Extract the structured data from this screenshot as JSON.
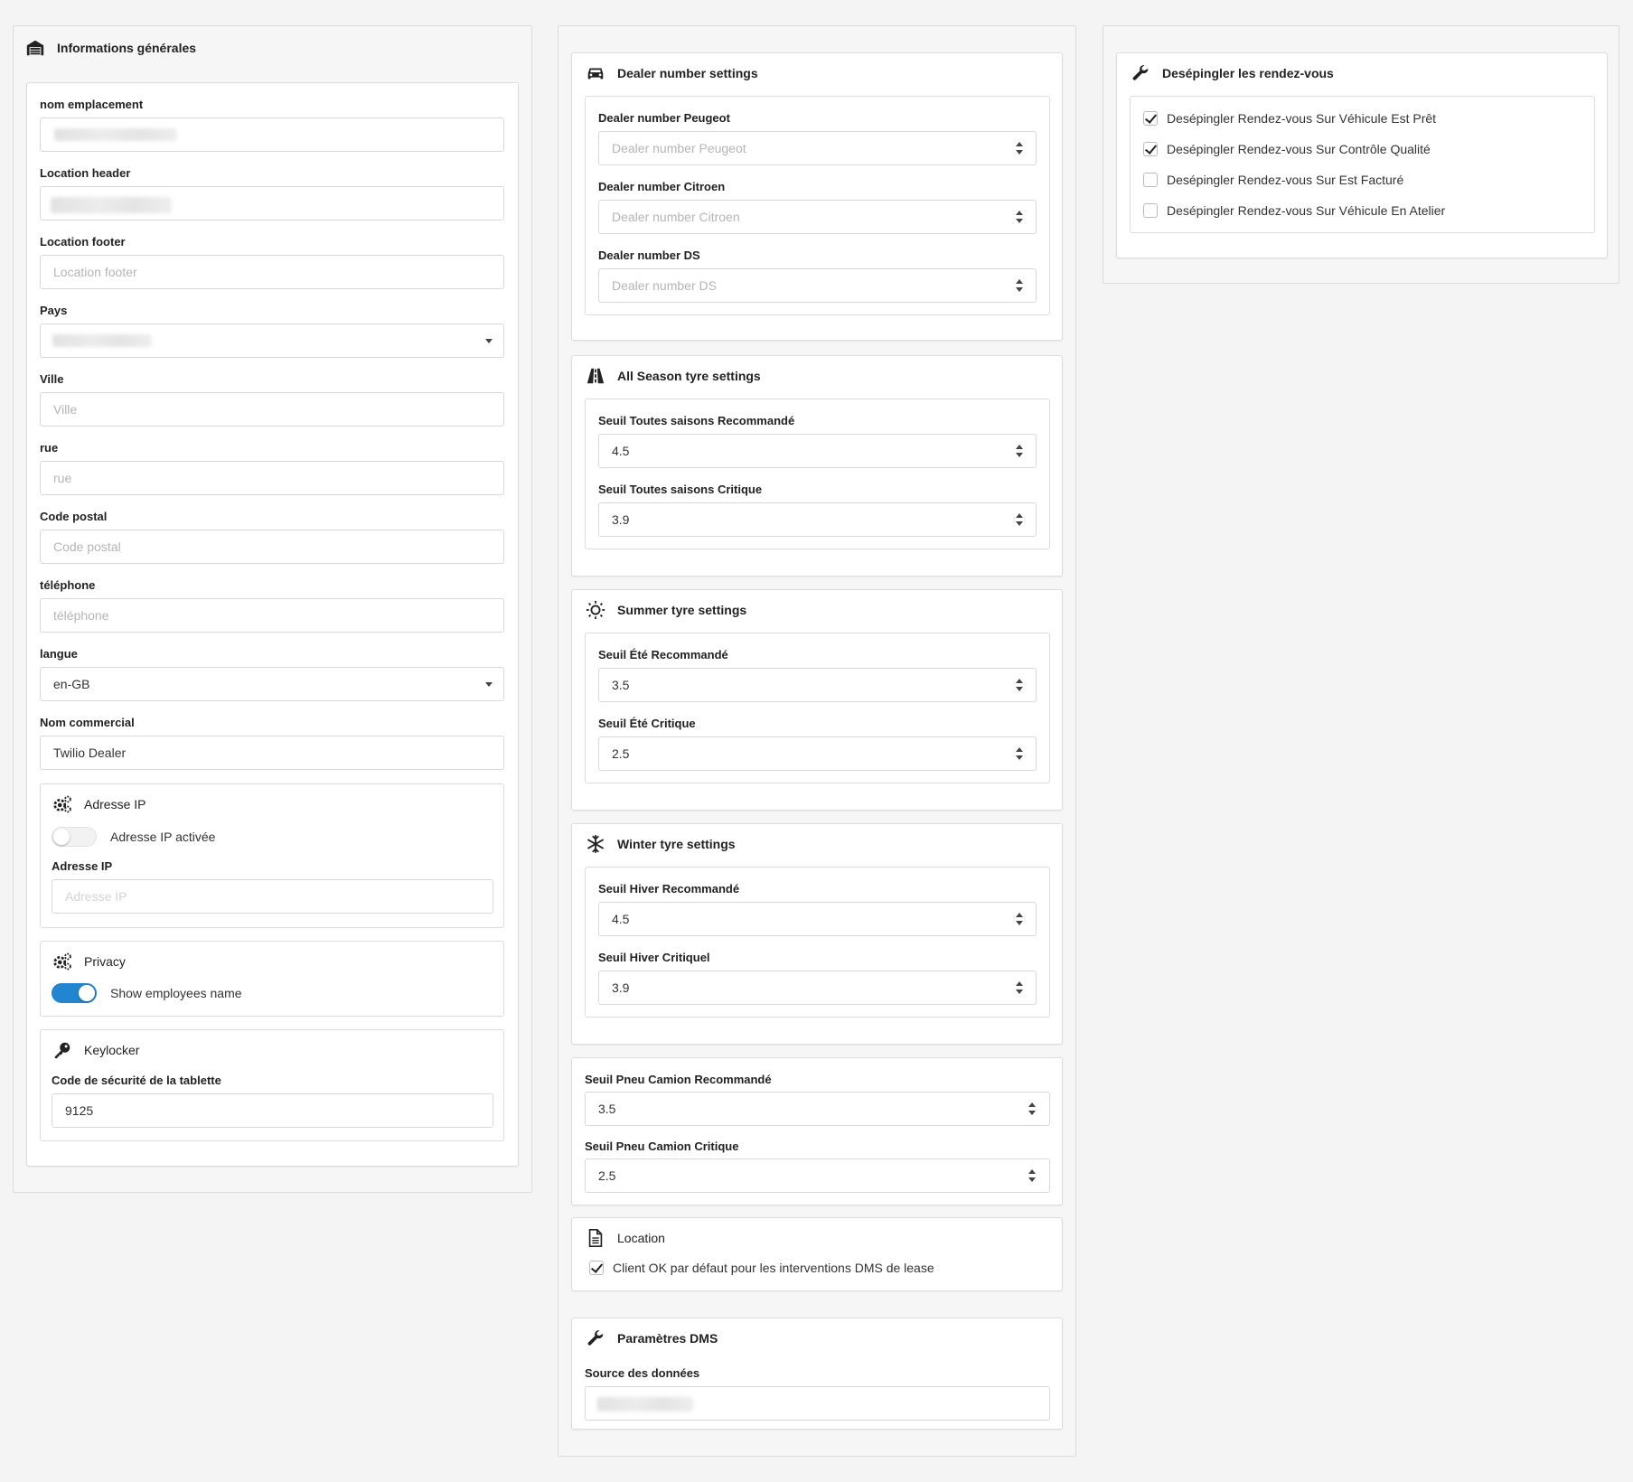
{
  "general": {
    "title": "Informations générales",
    "icon": "warehouse-icon",
    "fields": {
      "location_name": {
        "label": "nom emplacement",
        "value": ""
      },
      "location_header": {
        "label": "Location header",
        "value": ""
      },
      "location_footer": {
        "label": "Location footer",
        "placeholder": "Location footer"
      },
      "country": {
        "label": "Pays",
        "value": ""
      },
      "city": {
        "label": "Ville",
        "placeholder": "Ville"
      },
      "street": {
        "label": "rue",
        "placeholder": "rue"
      },
      "postal_code": {
        "label": "Code postal",
        "placeholder": "Code postal"
      },
      "phone": {
        "label": "téléphone",
        "placeholder": "téléphone"
      },
      "language": {
        "label": "langue",
        "value": "en-GB"
      },
      "commercial_name": {
        "label": "Nom commercial",
        "value": "Twilio Dealer"
      }
    },
    "ip": {
      "title": "Adresse IP",
      "icon": "cogs-icon",
      "toggle_label": "Adresse IP activée",
      "toggle_on": false,
      "field_label": "Adresse IP",
      "placeholder": "Adresse IP"
    },
    "privacy": {
      "title": "Privacy",
      "icon": "cogs-icon",
      "toggle_label": "Show employees name",
      "toggle_on": true
    },
    "keylocker": {
      "title": "Keylocker",
      "icon": "key-icon",
      "field_label": "Code de sécurité de la tablette",
      "value": "9125"
    }
  },
  "dealer": {
    "title": "Dealer number settings",
    "icon": "car-icon",
    "peugeot": {
      "label": "Dealer number Peugeot",
      "placeholder": "Dealer number Peugeot"
    },
    "citroen": {
      "label": "Dealer number Citroen",
      "placeholder": "Dealer number Citroen"
    },
    "ds": {
      "label": "Dealer number DS",
      "placeholder": "Dealer number DS"
    }
  },
  "all_season": {
    "title": "All Season tyre settings",
    "icon": "road-icon",
    "recommended": {
      "label": "Seuil Toutes saisons Recommandé",
      "value": "4.5"
    },
    "critical": {
      "label": "Seuil Toutes saisons Critique",
      "value": "3.9"
    }
  },
  "summer": {
    "title": "Summer tyre settings",
    "icon": "sun-icon",
    "recommended": {
      "label": "Seuil Été Recommandé",
      "value": "3.5"
    },
    "critical": {
      "label": "Seuil Été Critique",
      "value": "2.5"
    }
  },
  "winter": {
    "title": "Winter tyre settings",
    "icon": "snowflake-icon",
    "recommended": {
      "label": "Seuil Hiver Recommandé",
      "value": "4.5"
    },
    "critical": {
      "label": "Seuil Hiver Critiquel",
      "value": "3.9"
    }
  },
  "truck": {
    "recommended": {
      "label": "Seuil Pneu Camion Recommandé",
      "value": "3.5"
    },
    "critical": {
      "label": "Seuil Pneu Camion Critique",
      "value": "2.5"
    }
  },
  "location": {
    "title": "Location",
    "icon": "file-icon",
    "checkbox_label": "Client OK par défaut pour les interventions DMS de lease",
    "checked": true
  },
  "dms": {
    "title": "Paramètres DMS",
    "icon": "wrench-icon",
    "source_label": "Source des données",
    "source_value": ""
  },
  "unpin": {
    "title": "Desépingler les rendez-vous",
    "icon": "wrench-icon",
    "items": [
      {
        "label": "Desépingler Rendez-vous Sur Véhicule Est Prêt",
        "checked": true
      },
      {
        "label": "Desépingler Rendez-vous Sur Contrôle Qualité",
        "checked": true
      },
      {
        "label": "Desépingler Rendez-vous Sur Est Facturé",
        "checked": false
      },
      {
        "label": "Desépingler Rendez-vous Sur Véhicule En Atelier",
        "checked": false
      }
    ]
  },
  "colors": {
    "toggle_on": "#2185d0",
    "border": "#dcdcdc",
    "background": "#f4f4f4"
  }
}
